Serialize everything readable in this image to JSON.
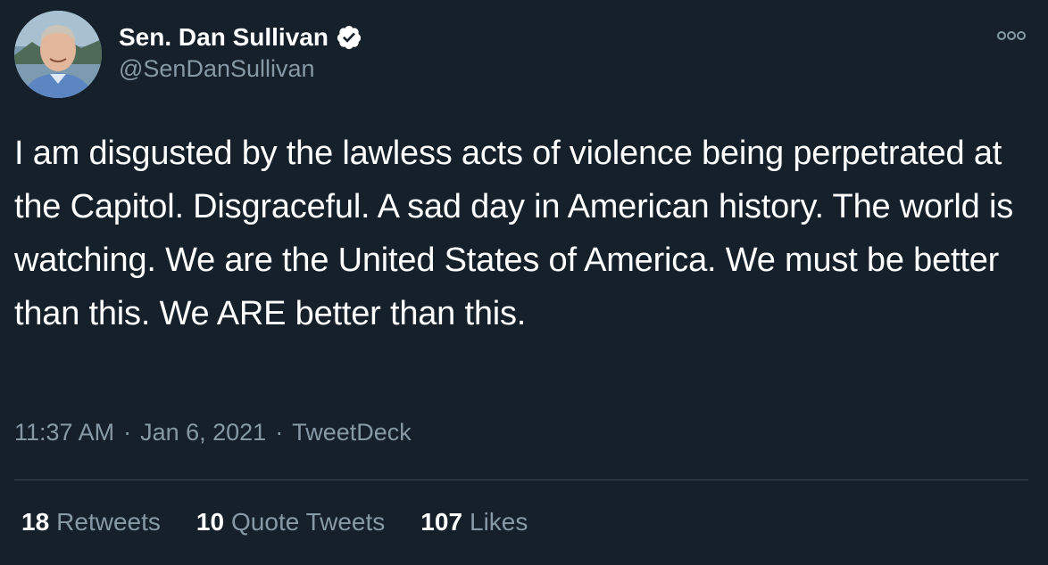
{
  "author": {
    "display_name": "Sen. Dan Sullivan",
    "handle": "@SenDanSullivan",
    "verified_icon": "verified-badge-icon"
  },
  "tweet": {
    "text": "I am disgusted by the lawless acts of violence being perpetrated at the Capitol. Disgraceful. A sad day in American history. The world is watching. We are the United States of America. We must be better than this. We ARE better than this."
  },
  "meta": {
    "time": "11:37 AM",
    "separator": "·",
    "date": "Jan 6, 2021",
    "source": "TweetDeck"
  },
  "stats": {
    "retweets_count": "18",
    "retweets_label": "Retweets",
    "quotes_count": "10",
    "quotes_label": "Quote Tweets",
    "likes_count": "107",
    "likes_label": "Likes"
  },
  "colors": {
    "background": "#15202b",
    "primary_text": "#ffffff",
    "secondary_text": "#8899a6",
    "divider": "#38444d"
  }
}
